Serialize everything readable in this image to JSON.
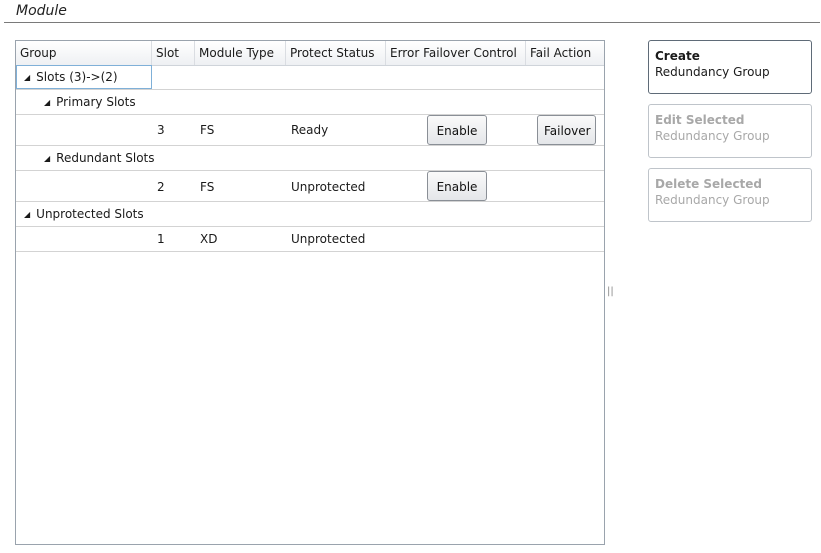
{
  "section": {
    "title": "Module"
  },
  "grid": {
    "columns": [
      "Group",
      "Slot",
      "Module Type",
      "Protect Status",
      "Error Failover Control",
      "Fail Action"
    ],
    "root": {
      "label": "Slots (3)->(2)"
    },
    "primary": {
      "label": "Primary Slots",
      "row": {
        "slot": "3",
        "type": "FS",
        "status": "Ready",
        "control": "Enable",
        "action": "Failover"
      }
    },
    "redundant": {
      "label": "Redundant Slots",
      "row": {
        "slot": "2",
        "type": "FS",
        "status": "Unprotected",
        "control": "Enable"
      }
    },
    "unprotected": {
      "label": "Unprotected Slots",
      "row": {
        "slot": "1",
        "type": "XD",
        "status": "Unprotected"
      }
    }
  },
  "actions": {
    "create": {
      "line1": "Create",
      "line2": "Redundancy Group"
    },
    "edit": {
      "line1": "Edit Selected",
      "line2": "Redundancy Group"
    },
    "delete": {
      "line1": "Delete Selected",
      "line2": "Redundancy Group"
    }
  },
  "splitter": {
    "glyph": "||"
  }
}
